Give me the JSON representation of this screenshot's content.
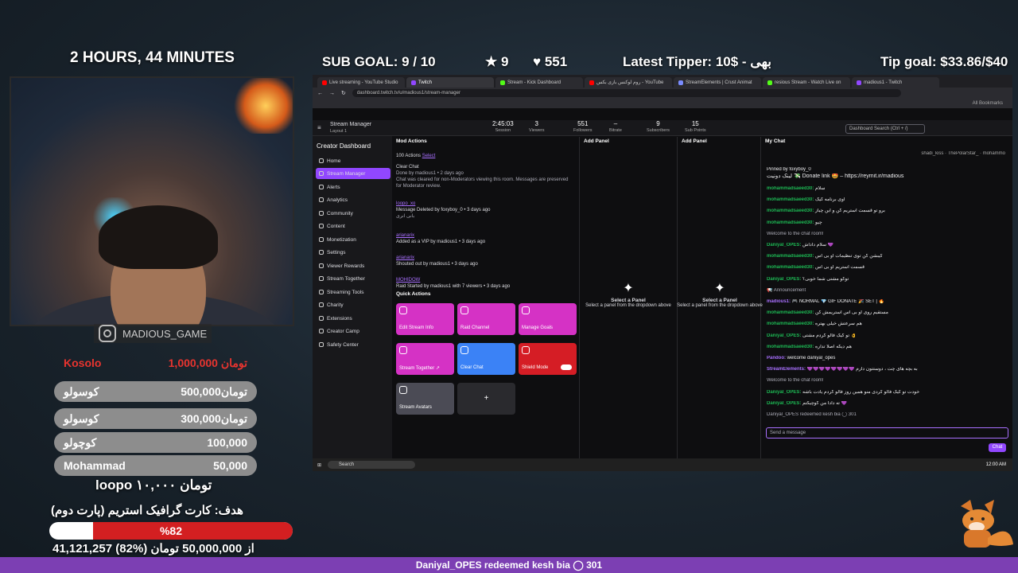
{
  "overlay": {
    "timer": "2 HOURS, 44 MINUTES",
    "sub_goal": "SUB GOAL: 9 / 10",
    "stars": "9",
    "hearts": "551",
    "latest_tipper": "Latest Tipper: 10$ - بهی",
    "tip_goal": "Tip goal: $33.86/$40",
    "instagram": "MADIOUS_GAME",
    "donors": [
      {
        "name": "Kosolo",
        "amount": "1,000,000 تومان"
      },
      {
        "name": "کوسولو",
        "amount": "500,000تومان"
      },
      {
        "name": "کوسولو",
        "amount": "300,000تومان"
      },
      {
        "name": "کوچولو",
        "amount": "100,000"
      },
      {
        "name": "Mohammad",
        "amount": "50,000"
      }
    ],
    "latest_donation": "loopo ۱۰,۰۰۰ تومان",
    "goal_title": "هدف: کارت گرافیک استریم (پارت دوم)",
    "goal_percent_label": "%82",
    "goal_percent": 82,
    "goal_amounts": "41,121,257 از 50,000,000 تومان (%82)",
    "banner": "Daniyal_OPES redeemed kesh bia ◯ 301"
  },
  "browser": {
    "tabs": [
      {
        "label": "Live streaming - YouTube Studio",
        "color": "#ff0000"
      },
      {
        "label": "Twitch",
        "color": "#9147ff",
        "active": true
      },
      {
        "label": "Stream - Kick Dashboard",
        "color": "#53fc18"
      },
      {
        "label": "روم لوکنس بازی بکس - YouTube",
        "color": "#ff0000"
      },
      {
        "label": "StreamElements | Crust Animat",
        "color": "#7a8cff"
      },
      {
        "label": "resious Stream - Watch Live on",
        "color": "#53fc18"
      },
      {
        "label": "madious1 - Twitch",
        "color": "#9147ff"
      }
    ],
    "url": "dashboard.twitch.tv/u/madious1/stream-manager",
    "bookmarks": "All Bookmarks"
  },
  "twitch": {
    "stream_manager": "Stream Manager",
    "layout": "Layout 1",
    "stats": [
      {
        "value": "2:45:03",
        "label": "Session"
      },
      {
        "value": "3",
        "label": "Viewers"
      },
      {
        "value": "551",
        "label": "Followers"
      },
      {
        "value": "–",
        "label": "Bitrate"
      },
      {
        "value": "9",
        "label": "Subscribers"
      },
      {
        "value": "15",
        "label": "Sub Points"
      }
    ],
    "dash_search": "Dashboard Search (Ctrl + /)",
    "sidebar_title": "Creator Dashboard",
    "sidebar": [
      "Home",
      "Stream Manager",
      "Alerts",
      "Analytics",
      "Community",
      "Content",
      "Monetization",
      "Settings",
      "Viewer Rewards",
      "Stream Together",
      "Streaming Tools",
      "Charity",
      "Extensions",
      "Creator Camp",
      "Safety Center"
    ],
    "mod_actions_title": "Mod Actions",
    "mod_actions_count": "100 Actions",
    "mod_actions_select": "Select",
    "add_panel": "Add Panel",
    "my_chat": "My Chat",
    "actions": [
      {
        "title": "Clear Chat",
        "sub": "Done by madious1 • 2 days ago",
        "note": "Chat was cleared for non-Moderators viewing this room. Messages are preserved for Moderator review."
      },
      {
        "title": "loopo_xo",
        "sub": "Message Deleted by foxyboy_0 • 3 days ago",
        "note": "بانی انری"
      },
      {
        "title": "arianarix",
        "sub": "Added as a VIP by madious1 • 3 days ago",
        "note": ""
      },
      {
        "title": "arianarix",
        "sub": "Shouted out by madious1 • 3 days ago",
        "note": ""
      },
      {
        "title": "MOHIDOW",
        "sub": "Raid Started by madious1 with 7 viewers • 3 days ago",
        "note": ""
      }
    ],
    "quick_actions_title": "Quick Actions",
    "quick_actions": [
      {
        "label": "Edit Stream Info",
        "color": "#d532c5"
      },
      {
        "label": "Raid Channel",
        "color": "#d532c5"
      },
      {
        "label": "Manage Goals",
        "color": "#d532c5"
      },
      {
        "label": "Stream Together ↗",
        "color": "#d532c5"
      },
      {
        "label": "Clear Chat",
        "color": "#3b82f6"
      },
      {
        "label": "Shield Mode",
        "color": "#d51d25"
      },
      {
        "label": "Stream Avatars",
        "color": "#4b4b55"
      }
    ],
    "add_plus": "+",
    "panel_empty_title": "Select a Panel",
    "panel_empty_sub": "Select a panel from the dropdown above",
    "chat_header_users": [
      "shadi_kiss",
      "ThePolarStar_",
      "mohammo"
    ],
    "pinned_by": "Pinned by foxyboy_0",
    "pinned": "لینک دونیت 💸 Donate link 🤩 – https://reymit.ir/madious",
    "chat_lines": [
      {
        "name": "mohammadsaeed30:",
        "msg": "سلام",
        "cls": ""
      },
      {
        "name": "mohammadsaeed30:",
        "msg": "اوی برنامه کیک",
        "cls": ""
      },
      {
        "name": "mohammadsaeed30:",
        "msg": "برو تو قسمت استریم کن و این چیاز",
        "cls": ""
      },
      {
        "name": "mohammadsaeed30:",
        "msg": "چیو",
        "cls": ""
      },
      {
        "name": "",
        "msg": "Welcome to the chat room!",
        "cls": "sys"
      },
      {
        "name": "Daniyal_OPES:",
        "msg": "سلام داداش 💜",
        "cls": ""
      },
      {
        "name": "mohammadsaeed30:",
        "msg": "کیبشن کن توی تنظیمات او بی اس",
        "cls": ""
      },
      {
        "name": "mohammadsaeed30:",
        "msg": "قسمت استریم او بی اس",
        "cls": ""
      },
      {
        "name": "Daniyal_OPES:",
        "msg": "توکو مشتی شما خوبی؟",
        "cls": ""
      },
      {
        "name": "",
        "msg": "📢 Announcement",
        "cls": "sys"
      },
      {
        "name": "madious1:",
        "msg": "🎮 NORMAL 💎 GIF DONATE 🎉 SET | 🔥",
        "cls": "purple"
      },
      {
        "name": "mohammadsaeed30:",
        "msg": "مستقیم روی او بی اس استریمش کن",
        "cls": ""
      },
      {
        "name": "mohammadsaeed30:",
        "msg": "هم سرعتش خیلی بهتره",
        "cls": ""
      },
      {
        "name": "Daniyal_OPES:",
        "msg": "تو کیک فالو کردم مشتی 👌",
        "cls": ""
      },
      {
        "name": "mohammadsaeed30:",
        "msg": "هم دیگه اصلا تداره",
        "cls": ""
      },
      {
        "name": "Pandoo:",
        "msg": "welcome daniyal_opes",
        "cls": "purple"
      },
      {
        "name": "StreamElements:",
        "msg": "💜💜💜💜💜💜💜💜 به بچه های چت ، دوستتون دارم",
        "cls": "purple"
      },
      {
        "name": "",
        "msg": "Welcome to the chat room!",
        "cls": "sys"
      },
      {
        "name": "Daniyal_OPES:",
        "msg": "خودت تو کیک فالو کردی منو همین روز فالو کردم یادت باشه",
        "cls": ""
      },
      {
        "name": "Daniyal_OPES:",
        "msg": "ته دادا من کوچیکتم 💜",
        "cls": ""
      },
      {
        "name": "",
        "msg": "Daniyal_OPES redeemed kesh bia ◯ 301",
        "cls": "sys"
      }
    ],
    "chat_placeholder": "Send a message",
    "chat_button": "Chat"
  },
  "taskbar": {
    "search": "Search",
    "clock": "12:00 AM"
  }
}
